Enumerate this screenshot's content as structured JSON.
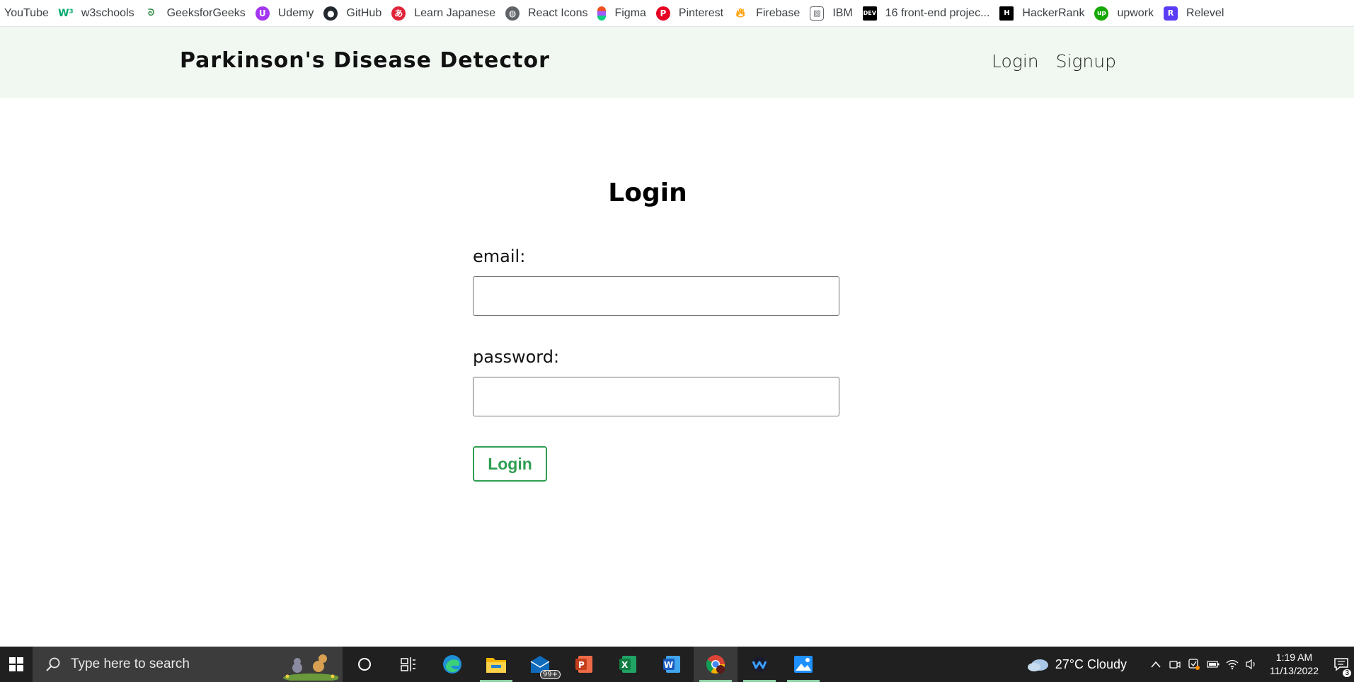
{
  "bookmarks": [
    {
      "label": "YouTube",
      "icon": "none"
    },
    {
      "label": "w3schools",
      "icon": "w3schools-icon",
      "color": "#04aa6d"
    },
    {
      "label": "GeeksforGeeks",
      "icon": "geeksforgeeks-icon",
      "color": "#2f8d46"
    },
    {
      "label": "Udemy",
      "icon": "udemy-icon",
      "color": "#a435f0"
    },
    {
      "label": "GitHub",
      "icon": "github-icon",
      "color": "#24292f"
    },
    {
      "label": "Learn Japanese",
      "icon": "learn-japanese-icon",
      "color": "#e0243a"
    },
    {
      "label": "React Icons",
      "icon": "globe-icon",
      "color": "#5f6368"
    },
    {
      "label": "Figma",
      "icon": "figma-icon",
      "color": "#f24e1e"
    },
    {
      "label": "Pinterest",
      "icon": "pinterest-icon",
      "color": "#e60023"
    },
    {
      "label": "Firebase",
      "icon": "firebase-icon",
      "color": "#ffa000"
    },
    {
      "label": "IBM",
      "icon": "image-icon",
      "color": "#5f6368"
    },
    {
      "label": "16 front-end projec...",
      "icon": "dev-icon",
      "color": "#000000"
    },
    {
      "label": "HackerRank",
      "icon": "hackerrank-icon",
      "color": "#1ba94c"
    },
    {
      "label": "upwork",
      "icon": "upwork-icon",
      "color": "#14a800"
    },
    {
      "label": "Relevel",
      "icon": "relevel-icon",
      "color": "#5b3df5"
    }
  ],
  "navbar": {
    "brand": "Parkinson's Disease Detector",
    "links": [
      "Login",
      "Signup"
    ]
  },
  "login": {
    "title": "Login",
    "email_label": "email:",
    "email_value": "",
    "password_label": "password:",
    "password_value": "",
    "submit_label": "Login"
  },
  "taskbar": {
    "search_placeholder": "Type here to search",
    "apps": [
      "cortana-icon",
      "task-view-icon",
      "edge-icon",
      "file-explorer-icon",
      "mail-icon",
      "powerpoint-icon",
      "excel-icon",
      "word-icon",
      "chrome-icon",
      "webex-icon",
      "photos-icon"
    ],
    "mail_badge": "99+",
    "weather": "27°C  Cloudy",
    "time": "1:19 AM",
    "date": "11/13/2022",
    "notification_count": "3"
  },
  "colors": {
    "navbar_bg": "#f0f8f1",
    "accent_green": "#2e9e52",
    "taskbar_bg": "#202020"
  }
}
